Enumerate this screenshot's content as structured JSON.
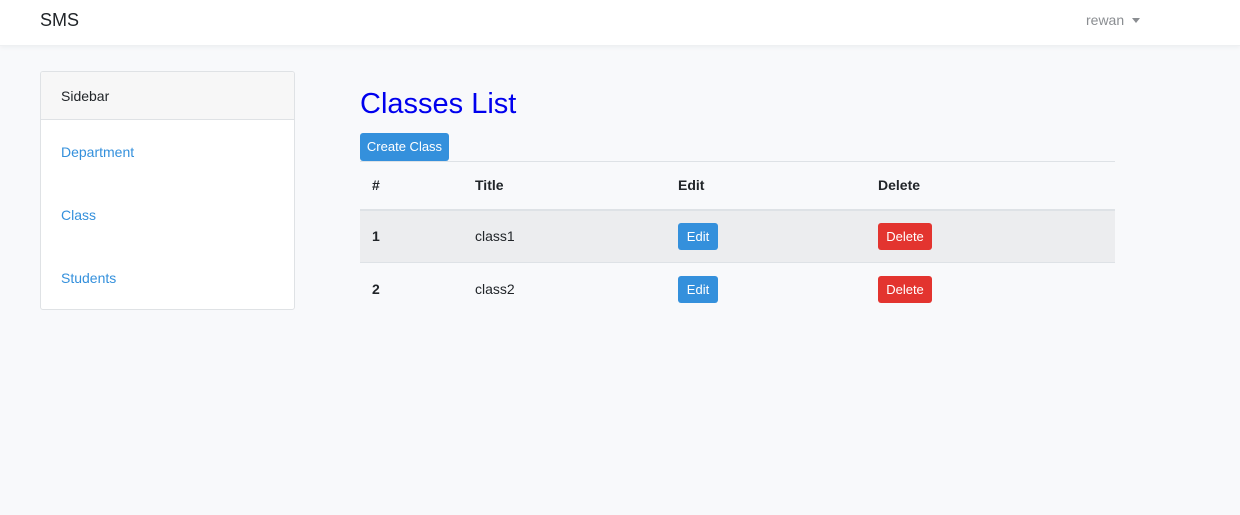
{
  "navbar": {
    "brand": "SMS",
    "user": "rewan"
  },
  "sidebar": {
    "header": "Sidebar",
    "items": [
      {
        "label": "Department"
      },
      {
        "label": "Class"
      },
      {
        "label": "Students"
      }
    ]
  },
  "main": {
    "title": "Classes List",
    "create_button": "Create Class",
    "table": {
      "headers": [
        "#",
        "Title",
        "Edit",
        "Delete"
      ],
      "rows": [
        {
          "num": "1",
          "title": "class1",
          "edit": "Edit",
          "delete": "Delete"
        },
        {
          "num": "2",
          "title": "class2",
          "edit": "Edit",
          "delete": "Delete"
        }
      ]
    }
  },
  "colors": {
    "primary": "#3490dc",
    "danger": "#e3342f",
    "title": "#0000ee"
  }
}
